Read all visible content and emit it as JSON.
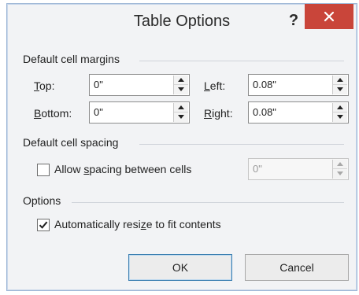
{
  "dialog": {
    "title": "Table Options",
    "help_label": "?",
    "close_icon": "close-icon"
  },
  "margins": {
    "section_label": "Default cell margins",
    "top": {
      "label_key": "T",
      "label_rest": "op:",
      "value": "0\""
    },
    "bottom": {
      "label_key": "B",
      "label_rest": "ottom:",
      "value": "0\""
    },
    "left": {
      "label_key": "L",
      "label_rest": "eft:",
      "value": "0.08\""
    },
    "right": {
      "label_key": "R",
      "label_rest": "ight:",
      "value": "0.08\""
    }
  },
  "spacing": {
    "section_label": "Default cell spacing",
    "allow_label_pre": "Allow ",
    "allow_label_key": "s",
    "allow_label_post": "pacing between cells",
    "allow_checked": false,
    "value": "0\""
  },
  "options": {
    "section_label": "Options",
    "resize_label_pre": "Automatically resi",
    "resize_label_key": "z",
    "resize_label_post": "e to fit contents",
    "resize_checked": true
  },
  "buttons": {
    "ok_label": "OK",
    "cancel_label": "Cancel"
  }
}
